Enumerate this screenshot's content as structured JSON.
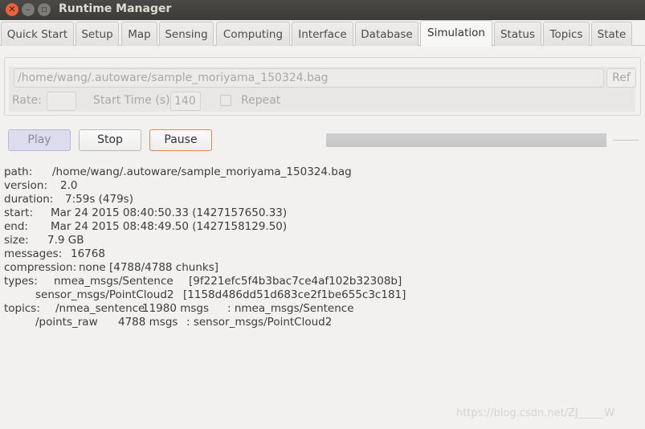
{
  "window": {
    "title": "Runtime Manager"
  },
  "tabs": [
    "Quick Start",
    "Setup",
    "Map",
    "Sensing",
    "Computing",
    "Interface",
    "Database",
    "Simulation",
    "Status",
    "Topics",
    "State"
  ],
  "active_tab": "Simulation",
  "simulation": {
    "bag_path": "/home/wang/.autoware/sample_moriyama_150324.bag",
    "ref_label": "Ref",
    "rate_label": "Rate:",
    "rate_value": "",
    "start_time_label": "Start Time (s):",
    "start_time_value": "140",
    "repeat_label": "Repeat",
    "repeat_checked": false,
    "play_label": "Play",
    "stop_label": "Stop",
    "pause_label": "Pause",
    "progress": 0
  },
  "info": {
    "path": {
      "k": "path:",
      "v": "/home/wang/.autoware/sample_moriyama_150324.bag"
    },
    "version": {
      "k": "version:",
      "v": "2.0"
    },
    "duration": {
      "k": "duration:",
      "v": "7:59s (479s)"
    },
    "start": {
      "k": "start:",
      "v": "Mar 24 2015 08:40:50.33 (1427157650.33)"
    },
    "end": {
      "k": "end:",
      "v": "Mar 24 2015 08:48:49.50 (1427158129.50)"
    },
    "size": {
      "k": "size:",
      "v": "7.9 GB"
    },
    "messages": {
      "k": "messages:",
      "v": "16768"
    },
    "compression": {
      "k": "compression:",
      "v": "none [4788/4788 chunks]"
    },
    "types": {
      "k": "types:",
      "rows": [
        {
          "type": "nmea_msgs/Sentence",
          "hash": "[9f221efc5f4b3bac7ce4af102b32308b]"
        },
        {
          "type": "sensor_msgs/PointCloud2",
          "hash": "[1158d486dd51d683ce2f1be655c3c181]"
        }
      ]
    },
    "topics": {
      "k": "topics:",
      "rows": [
        {
          "topic": "/nmea_sentence",
          "count": "11980 msgs",
          "type": ": nmea_msgs/Sentence"
        },
        {
          "topic": "/points_raw",
          "count": "4788 msgs",
          "type": ": sensor_msgs/PointCloud2"
        }
      ]
    }
  },
  "watermark": "https://blog.csdn.net/ZJ_____W",
  "colors": {
    "close": "#e9643a",
    "titlebar": "#3c3b37",
    "pause_border": "#e9825a",
    "play_bg": "#dcdcee"
  }
}
